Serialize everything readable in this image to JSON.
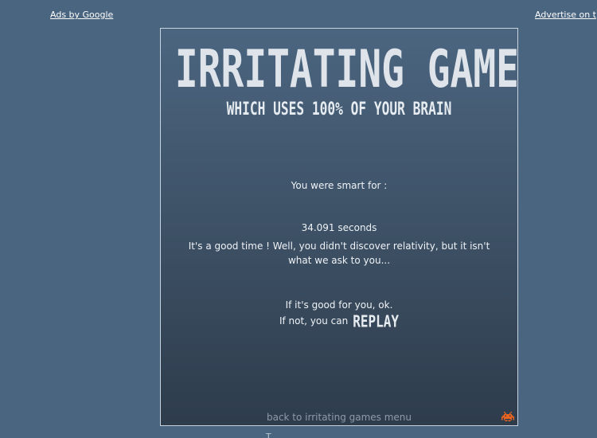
{
  "ads": {
    "left_label": "Ads by Google",
    "right_label": "Advertise on t"
  },
  "game": {
    "title": "IRRITATING GAME",
    "subtitle": "WHICH USES 100% OF YOUR BRAIN",
    "smart_label": "You were smart for :",
    "time_value": "34.091 seconds",
    "comment": "It's a good time ! Well, you didn't discover relativity, but it isn't what we ask to you...",
    "good_line": "If it's good for you, ok.",
    "not_line": "If not, you can",
    "replay_label": "REPLAY",
    "back_link": "back to irritating games menu",
    "icon": "space-invader-icon",
    "icon_color": "#e8641e"
  },
  "footer": {
    "text": "T"
  }
}
